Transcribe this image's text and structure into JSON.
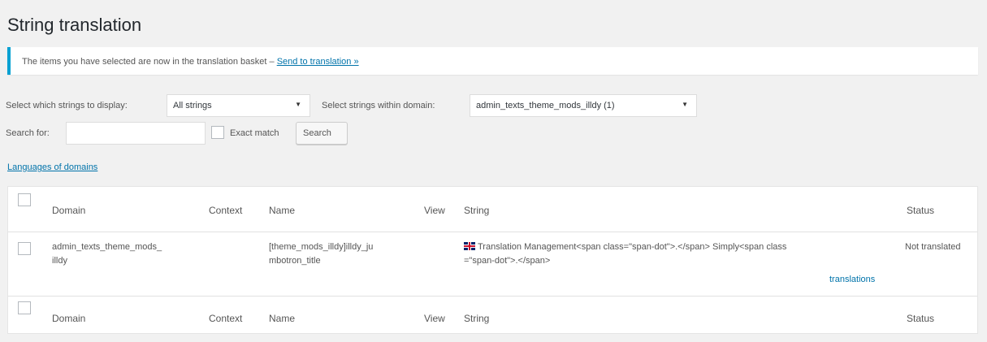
{
  "page": {
    "title": "String translation"
  },
  "notice": {
    "text": "The items you have selected are now in the translation basket –",
    "link": "Send to translation »"
  },
  "filters": {
    "display_label": "Select which strings to display:",
    "display_value": "All strings",
    "domain_label": "Select strings within domain:",
    "domain_value": "admin_texts_theme_mods_illdy (1)",
    "search_label": "Search for:",
    "search_value": "",
    "exact_match_label": "Exact match",
    "search_button": "Search"
  },
  "languages_link": "Languages of domains",
  "table": {
    "headers": {
      "domain": "Domain",
      "context": "Context",
      "name": "Name",
      "view": "View",
      "string": "String",
      "status": "Status"
    },
    "rows": [
      {
        "domain_line1": "admin_texts_theme_mods_",
        "domain_line2": "illdy",
        "context": "",
        "name_line1": "[theme_mods_illdy]illdy_ju",
        "name_line2": "mbotron_title",
        "view": "",
        "string_line1": "Translation Management<span class=\"span-dot\">.</span> Simply<span class",
        "string_line2": "=\"span-dot\">.</span>",
        "translations_link": "translations",
        "status": "Not translated",
        "flag_icon": "uk-flag-icon"
      }
    ]
  }
}
